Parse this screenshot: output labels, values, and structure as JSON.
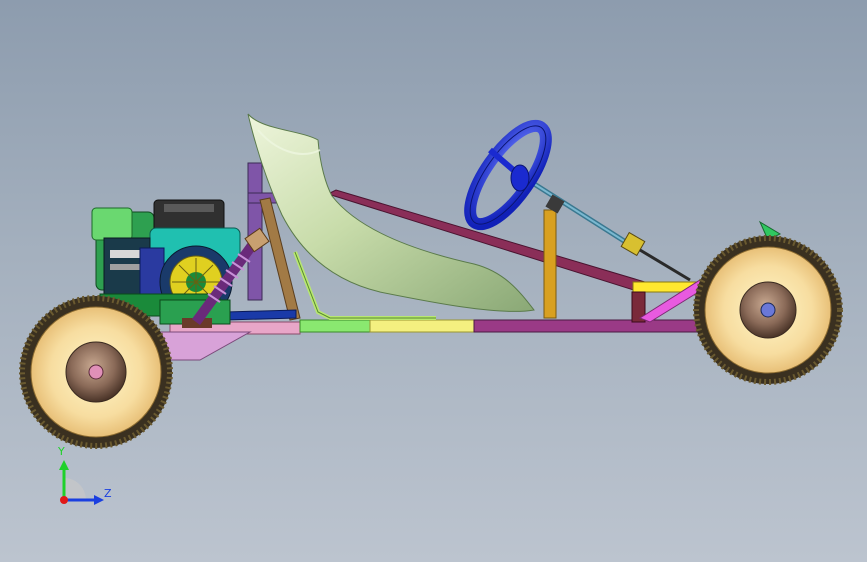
{
  "viewport": {
    "background_top": "#8d9cae",
    "background_bottom": "#bcc4cf"
  },
  "model": {
    "parts": [
      "rear-wheel",
      "front-wheel",
      "engine",
      "seat",
      "steering-wheel",
      "steering-column",
      "frame",
      "rear-shock-absorber",
      "tie-rod"
    ]
  },
  "triad": {
    "y_label": "Y",
    "z_label": "Z",
    "y_color": "#1fd12a",
    "z_color": "#1a3fe0",
    "x_color": "#e01818"
  }
}
